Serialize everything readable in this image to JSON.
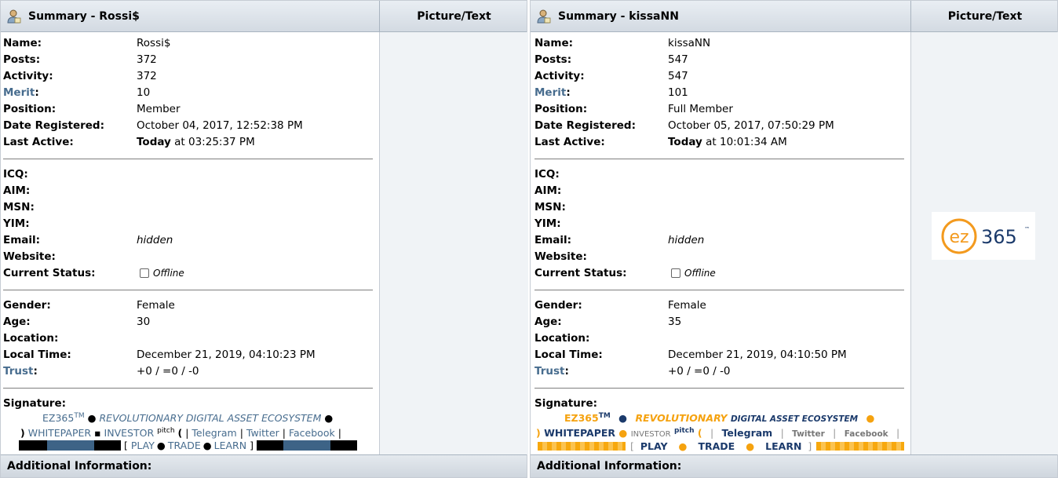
{
  "profiles": [
    {
      "summary_title": "Summary - Rossi$",
      "picture_header": "Picture/Text",
      "fields1": [
        {
          "label": "Name:",
          "value": "Rossi$"
        },
        {
          "label": "Posts:",
          "value": "372"
        },
        {
          "label": "Activity:",
          "value": "372"
        },
        {
          "label": "Merit",
          "value": "10"
        },
        {
          "label": "Position:",
          "value": "Member"
        },
        {
          "label": "Date Registered:",
          "value": "October 04, 2017, 12:52:38 PM"
        }
      ],
      "last_active": {
        "label": "Last Active:",
        "bold": "Today",
        "rest": " at 03:25:37 PM"
      },
      "contact": [
        {
          "label": "ICQ:",
          "value": ""
        },
        {
          "label": "AIM:",
          "value": ""
        },
        {
          "label": "MSN:",
          "value": ""
        },
        {
          "label": "YIM:",
          "value": ""
        },
        {
          "label": "Email:",
          "value": "hidden"
        },
        {
          "label": "Website:",
          "value": ""
        }
      ],
      "status": {
        "label": "Current Status:",
        "value": "Offline"
      },
      "personal": [
        {
          "label": "Gender:",
          "value": "Female"
        },
        {
          "label": "Age:",
          "value": "30"
        },
        {
          "label": "Location:",
          "value": ""
        },
        {
          "label": "Local Time:",
          "value": "December 21, 2019, 04:10:23 PM"
        },
        {
          "label": "Trust",
          "value": "+0 / =0 / -0"
        }
      ],
      "signature_label": "Signature:",
      "signature": {
        "brand": "EZ365",
        "tm": "TM",
        "tagline": "REVOLUTIONARY DIGITAL ASSET ECOSYSTEM",
        "whitepaper": "WHITEPAPER",
        "investor": "INVESTOR",
        "pitch": "pitch",
        "telegram": "Telegram",
        "twitter": "Twitter",
        "facebook": "Facebook",
        "play": "PLAY",
        "trade": "TRADE",
        "learn": "LEARN"
      },
      "additional": "Additional Information:"
    },
    {
      "summary_title": "Summary - kissaNN",
      "picture_header": "Picture/Text",
      "fields1": [
        {
          "label": "Name:",
          "value": "kissaNN"
        },
        {
          "label": "Posts:",
          "value": "547"
        },
        {
          "label": "Activity:",
          "value": "547"
        },
        {
          "label": "Merit",
          "value": "101"
        },
        {
          "label": "Position:",
          "value": "Full Member"
        },
        {
          "label": "Date Registered:",
          "value": "October 05, 2017, 07:50:29 PM"
        }
      ],
      "last_active": {
        "label": "Last Active:",
        "bold": "Today",
        "rest": " at 10:01:34 AM"
      },
      "contact": [
        {
          "label": "ICQ:",
          "value": ""
        },
        {
          "label": "AIM:",
          "value": ""
        },
        {
          "label": "MSN:",
          "value": ""
        },
        {
          "label": "YIM:",
          "value": ""
        },
        {
          "label": "Email:",
          "value": "hidden"
        },
        {
          "label": "Website:",
          "value": ""
        }
      ],
      "status": {
        "label": "Current Status:",
        "value": "Offline"
      },
      "personal": [
        {
          "label": "Gender:",
          "value": "Female"
        },
        {
          "label": "Age:",
          "value": "35"
        },
        {
          "label": "Location:",
          "value": ""
        },
        {
          "label": "Local Time:",
          "value": "December 21, 2019, 04:10:50 PM"
        },
        {
          "label": "Trust",
          "value": "+0 / =0 / -0"
        }
      ],
      "signature_label": "Signature:",
      "signature": {
        "brand": "EZ365",
        "tm": "TM",
        "tagline_a": "REVOLUTIONARY",
        "tagline_b": "DIGITAL ASSET ECOSYSTEM",
        "whitepaper": "WHITEPAPER",
        "investor": "INVESTOR",
        "pitch": "pitch",
        "telegram": "Telegram",
        "twitter": "Twitter",
        "facebook": "Facebook",
        "play": "PLAY",
        "trade": "TRADE",
        "learn": "LEARN"
      },
      "avatar_logo": {
        "ez": "ez",
        "num": "365",
        "tm": "™"
      },
      "additional": "Additional Information:"
    }
  ],
  "colors": {
    "link": "#476c8e",
    "orange": "#f5a20f",
    "navy": "#1b3a6b"
  },
  "icons": [
    "user-summary-icon",
    "checkbox-offline-icon"
  ]
}
